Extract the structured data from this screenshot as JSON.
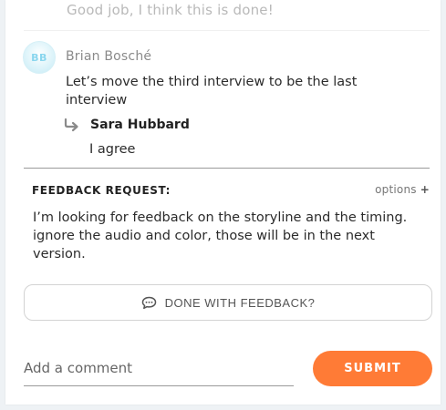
{
  "previous_comment": {
    "text": "Good job, I think this is done!"
  },
  "comment": {
    "avatar_initials": "BB",
    "author": "Brian Bosché",
    "text": "Let’s move the third interview to be the last interview",
    "reply": {
      "author": "Sara Hubbard",
      "text": "I agree"
    }
  },
  "feedback_request": {
    "label": "FEEDBACK REQUEST:",
    "options_label": "options",
    "options_icon": "+",
    "text": "I’m looking for feedback on the storyline and the timing. ignore the audio and color, those will be in the next version.",
    "done_label": "DONE WITH FEEDBACK?",
    "done_icon": "speech-bubble-icon"
  },
  "composer": {
    "placeholder": "Add a comment",
    "value": "",
    "submit_label": "SUBMIT"
  },
  "colors": {
    "accent": "#ff7b36",
    "avatar_bg": "#c5ebf6",
    "avatar_text": "#8ad6ee",
    "page_bg": "#eef2f5"
  }
}
